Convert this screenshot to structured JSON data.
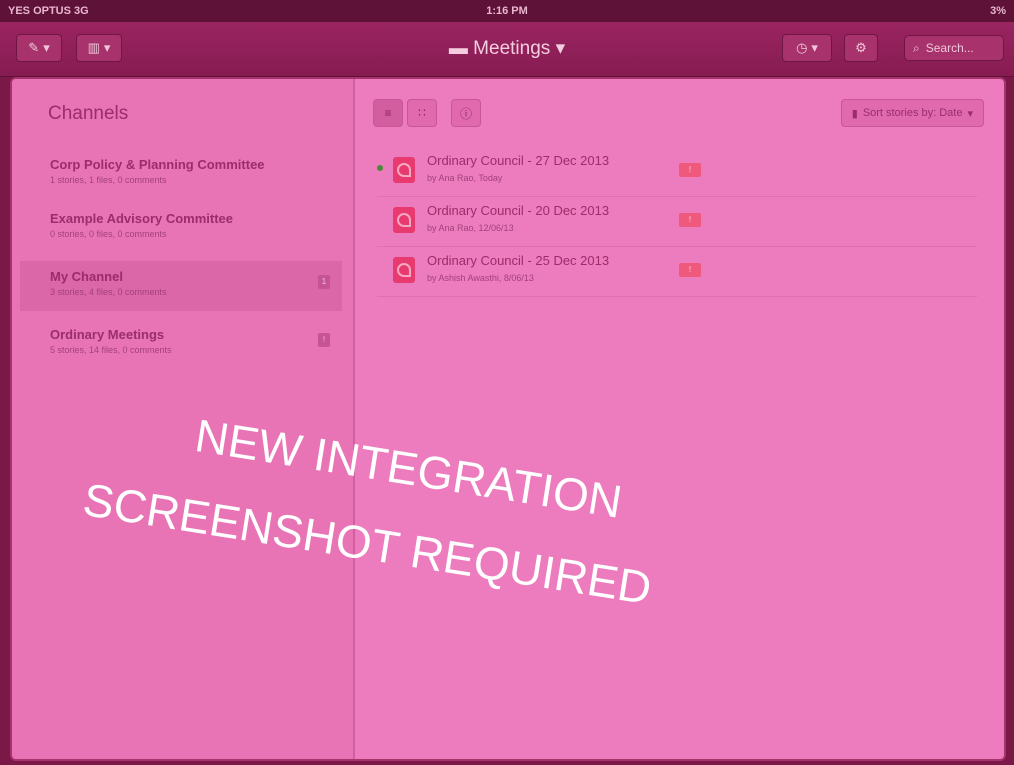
{
  "status": {
    "carrier": "YES OPTUS 3G",
    "time": "1:16 PM",
    "battery": "3%"
  },
  "toolbar": {
    "title": "Meetings",
    "search_placeholder": "Search...",
    "icons": [
      "pencil-icon",
      "layout-icon",
      "clock-icon",
      "gear-icon",
      "search-icon",
      "folder-icon"
    ]
  },
  "sidebar": {
    "title": "Channels",
    "channels": [
      {
        "name": "Corp Policy & Planning Committee",
        "meta": "1 stories, 1 files, 0 comments",
        "badge": ""
      },
      {
        "name": "Example Advisory Committee",
        "meta": "0 stories, 0 files, 0 comments",
        "badge": ""
      },
      {
        "name": "My Channel",
        "meta": "3 stories, 4 files, 0 comments",
        "badge": "1"
      },
      {
        "name": "Ordinary Meetings",
        "meta": "5 stories, 14 files, 0 comments",
        "badge": "!"
      }
    ]
  },
  "main": {
    "sort_label": "Sort stories by: Date",
    "stories": [
      {
        "title": "Ordinary Council - 27 Dec 2013",
        "by": "by Ana Rao, Today",
        "flag": "!",
        "new": true
      },
      {
        "title": "Ordinary Council - 20 Dec 2013",
        "by": "by Ana Rao, 12/06/13",
        "flag": "!",
        "new": false
      },
      {
        "title": "Ordinary Council - 25 Dec 2013",
        "by": "by Ashish Awasthi, 8/06/13",
        "flag": "!",
        "new": false
      }
    ]
  },
  "overlay": {
    "line1": "NEW INTEGRATION",
    "line2": "SCREENSHOT REQUIRED"
  },
  "colors": {
    "tint": "#ec7cbe",
    "toolbar": "#9a2460",
    "text": "#9a2d6a",
    "flag": "#ef5a7c"
  }
}
